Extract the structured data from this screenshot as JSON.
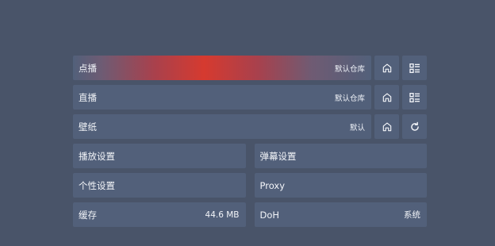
{
  "rows": [
    {
      "label": "点播",
      "value": "默认仓库",
      "btn1_icon": "home-icon",
      "btn2_icon": "list-icon"
    },
    {
      "label": "直播",
      "value": "默认仓库",
      "btn1_icon": "home-icon",
      "btn2_icon": "list-icon"
    },
    {
      "label": "壁纸",
      "value": "默认",
      "btn1_icon": "home-icon",
      "btn2_icon": "refresh-icon"
    }
  ],
  "pairs": [
    {
      "left": {
        "label": "播放设置",
        "value": ""
      },
      "right": {
        "label": "弹幕设置",
        "value": ""
      }
    },
    {
      "left": {
        "label": "个性设置",
        "value": ""
      },
      "right": {
        "label": "Proxy",
        "value": ""
      }
    },
    {
      "left": {
        "label": "缓存",
        "value": "44.6 MB"
      },
      "right": {
        "label": "DoH",
        "value": "系统"
      }
    }
  ],
  "colors": {
    "background": "#495469",
    "card": "#52607a",
    "highlight": "#d63a2f"
  }
}
